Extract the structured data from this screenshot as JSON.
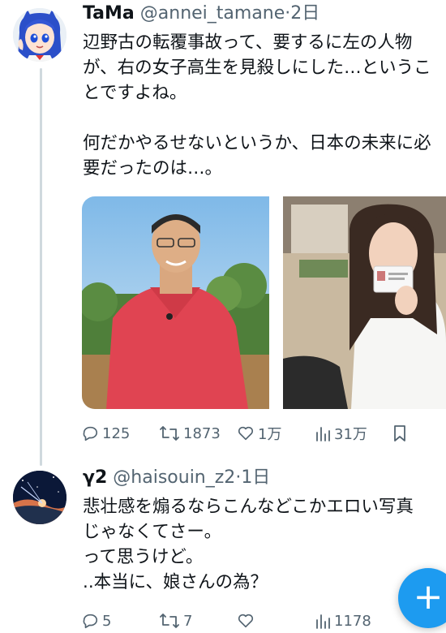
{
  "tweets": [
    {
      "display_name": "TaMa",
      "handle": "@annei_tamane",
      "separator": "·",
      "time": "2日",
      "lines": [
        "辺野古の転覆事故って、要するに左の人物",
        "が、右の女子高生を見殺しにした…というこ",
        "とですよね。",
        "",
        "何だかやるせないというか、日本の未来に必",
        "要だったのは…。"
      ],
      "stats": {
        "replies": "125",
        "retweets": "1873",
        "likes": "1万",
        "views": "31万"
      }
    },
    {
      "display_name": "γ2",
      "handle": "@haisouin_z2",
      "separator": "·",
      "time": "1日",
      "lines": [
        "悲壮感を煽るならこんなどこかエロい写真",
        "じゃなくてさー。",
        "って思うけど。",
        "..本当に、娘さんの為？"
      ],
      "stats": {
        "replies": "5",
        "retweets": "7",
        "likes": "",
        "views": "1178"
      }
    }
  ],
  "fab": {
    "label": "+"
  },
  "colors": {
    "accent": "#1d9bf0",
    "muted": "#536471",
    "thread_line": "#cfd9de"
  }
}
